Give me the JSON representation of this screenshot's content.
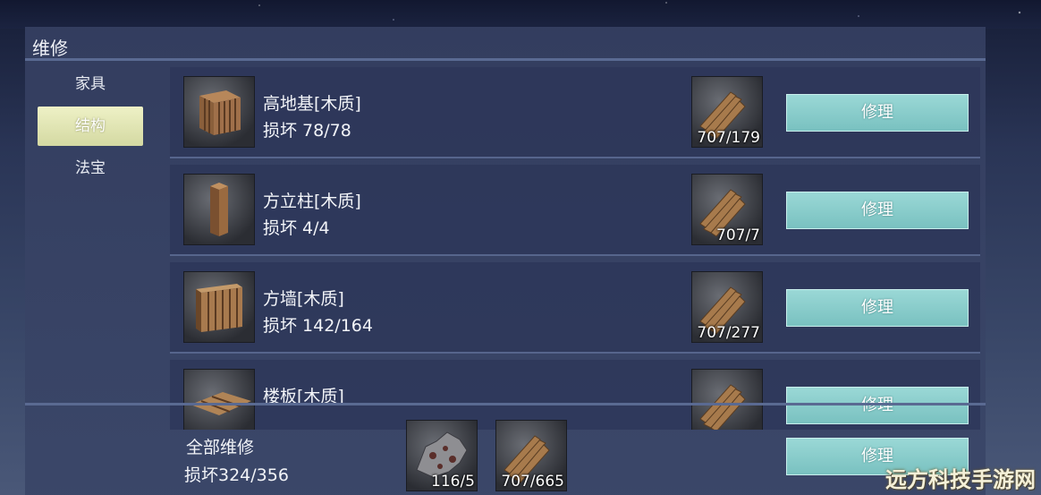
{
  "panel": {
    "title": "维修"
  },
  "categories": [
    {
      "label": "家具",
      "active": false
    },
    {
      "label": "结构",
      "active": true
    },
    {
      "label": "法宝",
      "active": false
    }
  ],
  "items": [
    {
      "name": "高地基[木质]",
      "damage": "损坏 78/78",
      "material_qty": "707/179",
      "icon": "wood-crate-icon",
      "button": "修理"
    },
    {
      "name": "方立柱[木质]",
      "damage": "损坏 4/4",
      "material_qty": "707/7",
      "icon": "wood-pillar-icon",
      "button": "修理"
    },
    {
      "name": "方墙[木质]",
      "damage": "损坏 142/164",
      "material_qty": "707/277",
      "icon": "wood-wall-icon",
      "button": "修理"
    },
    {
      "name": "楼板[木质]",
      "damage": "",
      "material_qty": "",
      "icon": "wood-floor-icon",
      "button": "修理"
    }
  ],
  "repair_all": {
    "label": "全部维修",
    "damage": "损坏324/356",
    "materials": [
      {
        "qty": "116/5",
        "icon": "hide-icon"
      },
      {
        "qty": "707/665",
        "icon": "wood-plank-icon"
      }
    ],
    "button": "修理"
  },
  "watermark": "远方科技手游网"
}
